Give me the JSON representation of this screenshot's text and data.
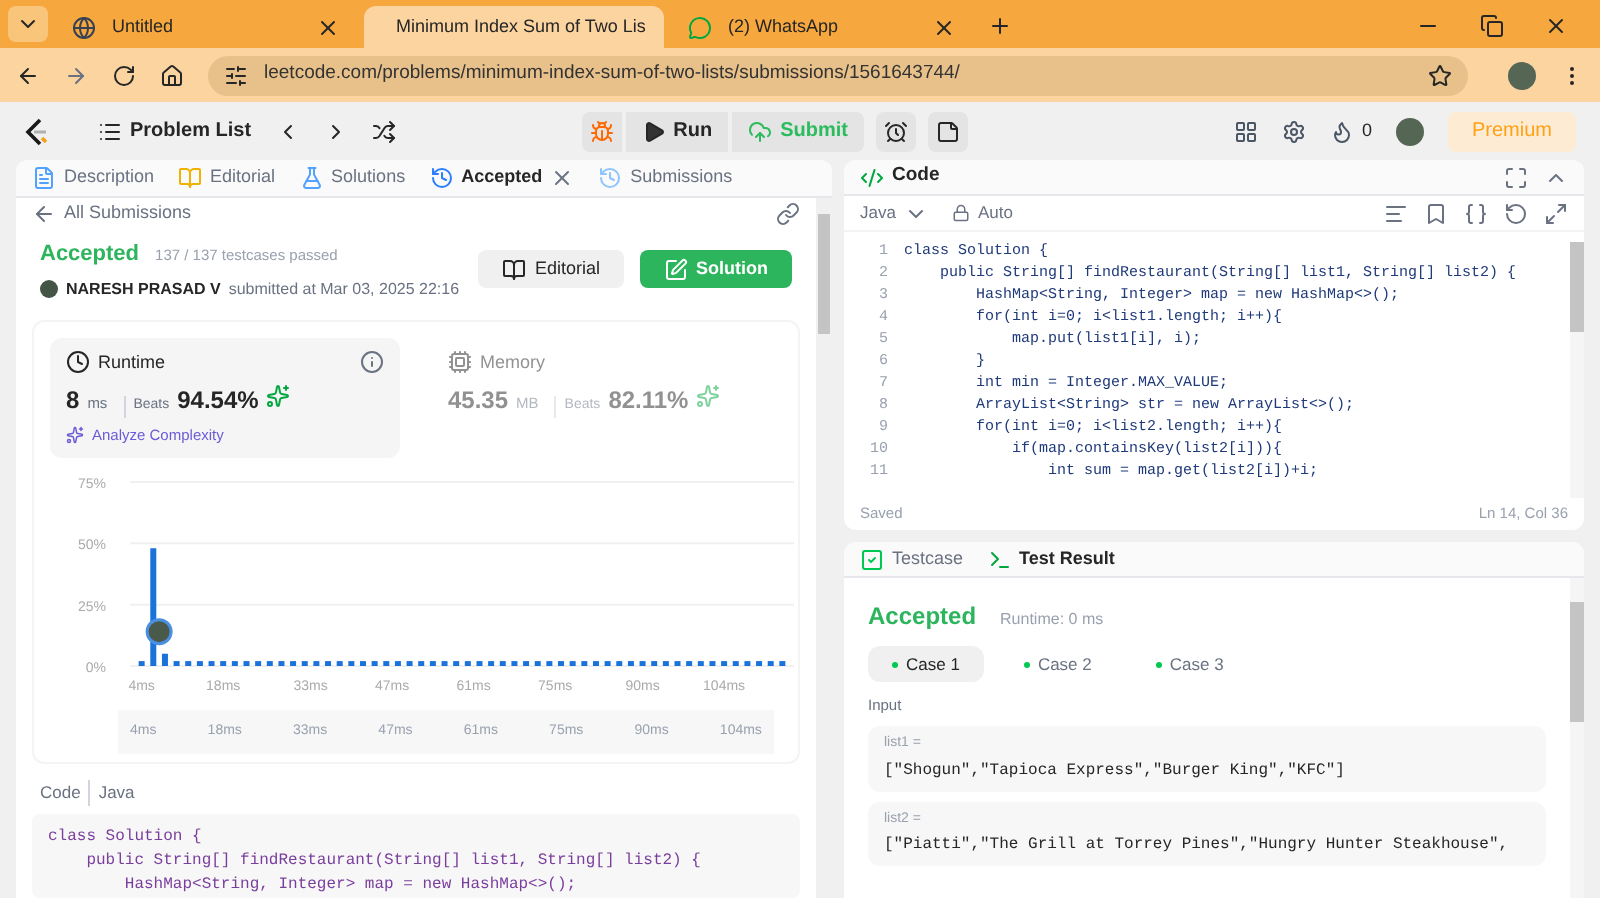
{
  "browser": {
    "tabs": [
      {
        "title": "Untitled",
        "kind": "globe",
        "selected": false
      },
      {
        "title": "Minimum Index Sum of Two Lis",
        "kind": "leetcode",
        "selected": true
      },
      {
        "title": "(2) WhatsApp",
        "kind": "whatsapp",
        "selected": false
      }
    ],
    "url": "leetcode.com/problems/minimum-index-sum-of-two-lists/submissions/1561643744/"
  },
  "navbar": {
    "problem_list": "Problem List",
    "run": "Run",
    "submit": "Submit",
    "streak": "0",
    "premium": "Premium"
  },
  "left_panel": {
    "tabs": [
      {
        "label": "Description",
        "kind": "description",
        "selected": false
      },
      {
        "label": "Editorial",
        "kind": "editorial",
        "selected": false
      },
      {
        "label": "Solutions",
        "kind": "solutions",
        "selected": false
      },
      {
        "label": "Accepted",
        "kind": "accepted",
        "selected": true
      },
      {
        "label": "Submissions",
        "kind": "submissions",
        "selected": false
      }
    ],
    "back_link": "All Submissions",
    "status": "Accepted",
    "testcases": "137 / 137 testcases passed",
    "author": "NARESH PRASAD V",
    "submitted": "submitted at Mar 03, 2025 22:16",
    "buttons": {
      "editorial": "Editorial",
      "solution": "Solution"
    },
    "stats": [
      {
        "kind": "runtime",
        "title": "Runtime",
        "value": "8",
        "unit": "ms",
        "beats_label": "Beats",
        "beats": "94.54%",
        "selected": true
      },
      {
        "kind": "memory",
        "title": "Memory",
        "value": "45.35",
        "unit": "MB",
        "beats_label": "Beats",
        "beats": "82.11%",
        "selected": false
      }
    ],
    "analyze": "Analyze Complexity",
    "chart_data": {
      "type": "bar",
      "ylim": [
        0,
        75
      ],
      "xlim": [
        2,
        116
      ],
      "yticks": [
        {
          "value": 0,
          "label": "0%"
        },
        {
          "value": 25,
          "label": "25%"
        },
        {
          "value": 50,
          "label": "50%"
        },
        {
          "value": 75,
          "label": "75%"
        }
      ],
      "xticks": [
        {
          "value": 4,
          "label": "4ms"
        },
        {
          "value": 18,
          "label": "18ms"
        },
        {
          "value": 33,
          "label": "33ms"
        },
        {
          "value": 47,
          "label": "47ms"
        },
        {
          "value": 61,
          "label": "61ms"
        },
        {
          "value": 75,
          "label": "75ms"
        },
        {
          "value": 90,
          "label": "90ms"
        },
        {
          "value": 104,
          "label": "104ms"
        }
      ],
      "x": [
        4,
        6,
        8,
        10,
        12,
        14,
        16,
        18,
        20,
        22,
        24,
        26,
        28,
        30,
        32,
        34,
        36,
        38,
        40,
        42,
        44,
        46,
        48,
        50,
        52,
        54,
        56,
        58,
        60,
        62,
        64,
        66,
        68,
        70,
        72,
        74,
        76,
        78,
        80,
        82,
        84,
        86,
        88,
        90,
        92,
        94,
        96,
        98,
        100,
        102,
        104,
        106,
        108,
        110,
        112,
        114
      ],
      "values": [
        2,
        48,
        5,
        2,
        2,
        2,
        2,
        2,
        2,
        2,
        2,
        2,
        2,
        2,
        2,
        2,
        2,
        2,
        2,
        2,
        2,
        2,
        2,
        2,
        2,
        2,
        2,
        2,
        2,
        2,
        2,
        2,
        2,
        2,
        2,
        2,
        2,
        2,
        2,
        2,
        2,
        2,
        2,
        2,
        2,
        2,
        2,
        2,
        2,
        2,
        2,
        2,
        2,
        2,
        2,
        2
      ]
    },
    "brush_labels": [
      "4ms",
      "18ms",
      "33ms",
      "47ms",
      "61ms",
      "75ms",
      "90ms",
      "104ms"
    ],
    "code_label": "Code",
    "code_language": "Java",
    "code_lines": [
      "class Solution {",
      "    public String[] findRestaurant(String[] list1, String[] list2) {",
      "        HashMap<String, Integer> map = new HashMap<>();"
    ]
  },
  "code_panel": {
    "title": "Code",
    "language": "Java",
    "mode": "Auto",
    "lines": [
      {
        "n": "1",
        "text": "class Solution {"
      },
      {
        "n": "2",
        "text": "    public String[] findRestaurant(String[] list1, String[] list2) {"
      },
      {
        "n": "3",
        "text": "        HashMap<String, Integer> map = new HashMap<>();"
      },
      {
        "n": "4",
        "text": "        for(int i=0; i<list1.length; i++){"
      },
      {
        "n": "5",
        "text": "            map.put(list1[i], i);"
      },
      {
        "n": "6",
        "text": "        }"
      },
      {
        "n": "7",
        "text": "        int min = Integer.MAX_VALUE;"
      },
      {
        "n": "8",
        "text": "        ArrayList<String> str = new ArrayList<>();"
      },
      {
        "n": "9",
        "text": "        for(int i=0; i<list2.length; i++){"
      },
      {
        "n": "10",
        "text": "            if(map.containsKey(list2[i])){"
      },
      {
        "n": "11",
        "text": "                int sum = map.get(list2[i])+i;"
      }
    ],
    "status": "Saved",
    "cursor": "Ln 14, Col 36"
  },
  "result_panel": {
    "tabs": [
      {
        "label": "Testcase",
        "kind": "testcase",
        "selected": false
      },
      {
        "label": "Test Result",
        "kind": "result",
        "selected": true
      }
    ],
    "status": "Accepted",
    "runtime": "Runtime: 0 ms",
    "cases": [
      {
        "label": "Case 1",
        "selected": true
      },
      {
        "label": "Case 2",
        "selected": false
      },
      {
        "label": "Case 3",
        "selected": false
      }
    ],
    "input_label": "Input",
    "inputs": [
      {
        "name": "list1 =",
        "value": "[\"Shogun\",\"Tapioca Express\",\"Burger King\",\"KFC\"]"
      },
      {
        "name": "list2 =",
        "value": "[\"Piatti\",\"The Grill at Torrey Pines\",\"Hungry Hunter Steakhouse\","
      }
    ]
  }
}
